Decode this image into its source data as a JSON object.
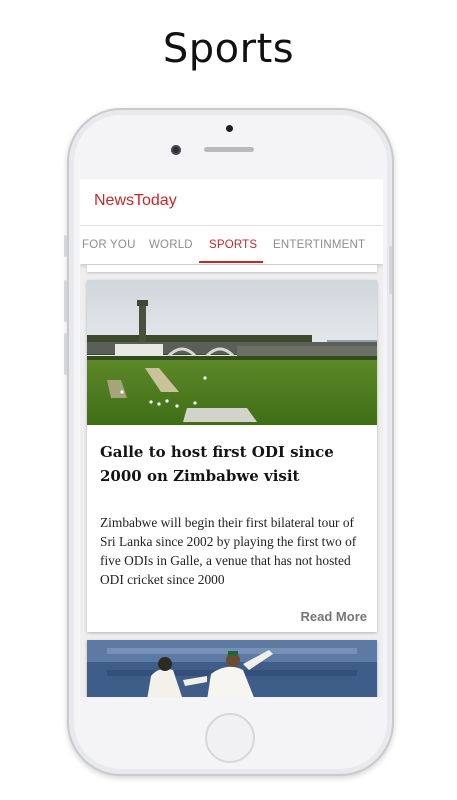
{
  "heading": "Sports",
  "app": {
    "title": "NewsToday"
  },
  "tabs": [
    {
      "label": "FOR YOU",
      "active": false
    },
    {
      "label": "WORLD",
      "active": false
    },
    {
      "label": "SPORTS",
      "active": true
    },
    {
      "label": "ENTERTINMENT",
      "active": false
    }
  ],
  "articles": [
    {
      "image": "cricket-stadium-photo",
      "title": "Galle to host first ODI since 2000 on Zimbabwe visit",
      "summary": "Zimbabwe will begin their first bilateral tour of Sri Lanka since 2002 by playing the first two of five ODIs in Galle, a venue that has not hosted ODI cricket since 2000",
      "action": "Read More"
    },
    {
      "image": "cricket-players-celebration-photo"
    }
  ],
  "colors": {
    "accent": "#c62828",
    "tab_inactive": "#8d8d8d",
    "read_more": "#757575"
  }
}
